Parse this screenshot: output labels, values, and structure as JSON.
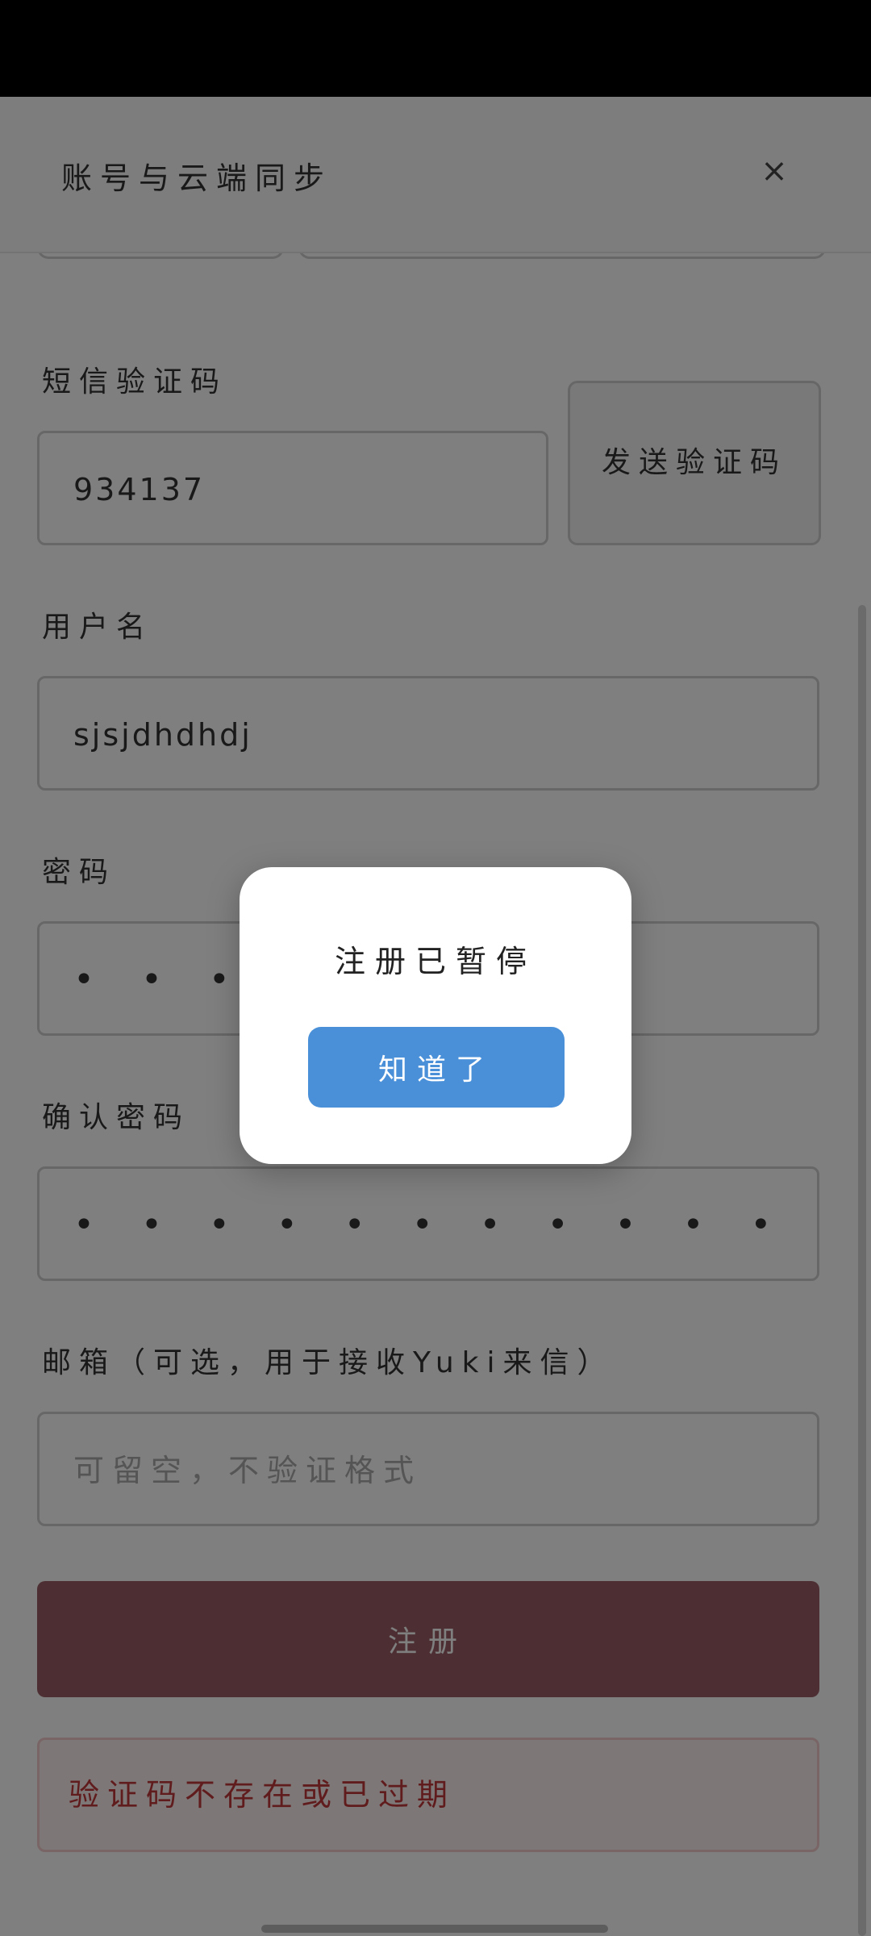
{
  "header": {
    "title": "账号与云端同步",
    "close_symbol": "×"
  },
  "form": {
    "sms_code": {
      "label": "短信验证码",
      "value": "934137",
      "send_button": "发送验证码"
    },
    "username": {
      "label": "用户名",
      "value": "sjsjdhdhdj"
    },
    "password": {
      "label": "密码",
      "value": "• • • •"
    },
    "confirm_password": {
      "label": "确认密码",
      "value": "• • • • • • • • • • •"
    },
    "email": {
      "label": "邮箱（可选，用于接收Yuki来信）",
      "placeholder": "可留空，不验证格式"
    },
    "register_button": "注册",
    "error_message": "验证码不存在或已过期"
  },
  "dialog": {
    "message": "注册已暂停",
    "button": "知道了"
  },
  "colors": {
    "register_button": "#9a5f66",
    "dialog_button": "#4a90d9",
    "error_text": "#c0393b",
    "overlay": "rgba(0,0,0,0.5)"
  }
}
